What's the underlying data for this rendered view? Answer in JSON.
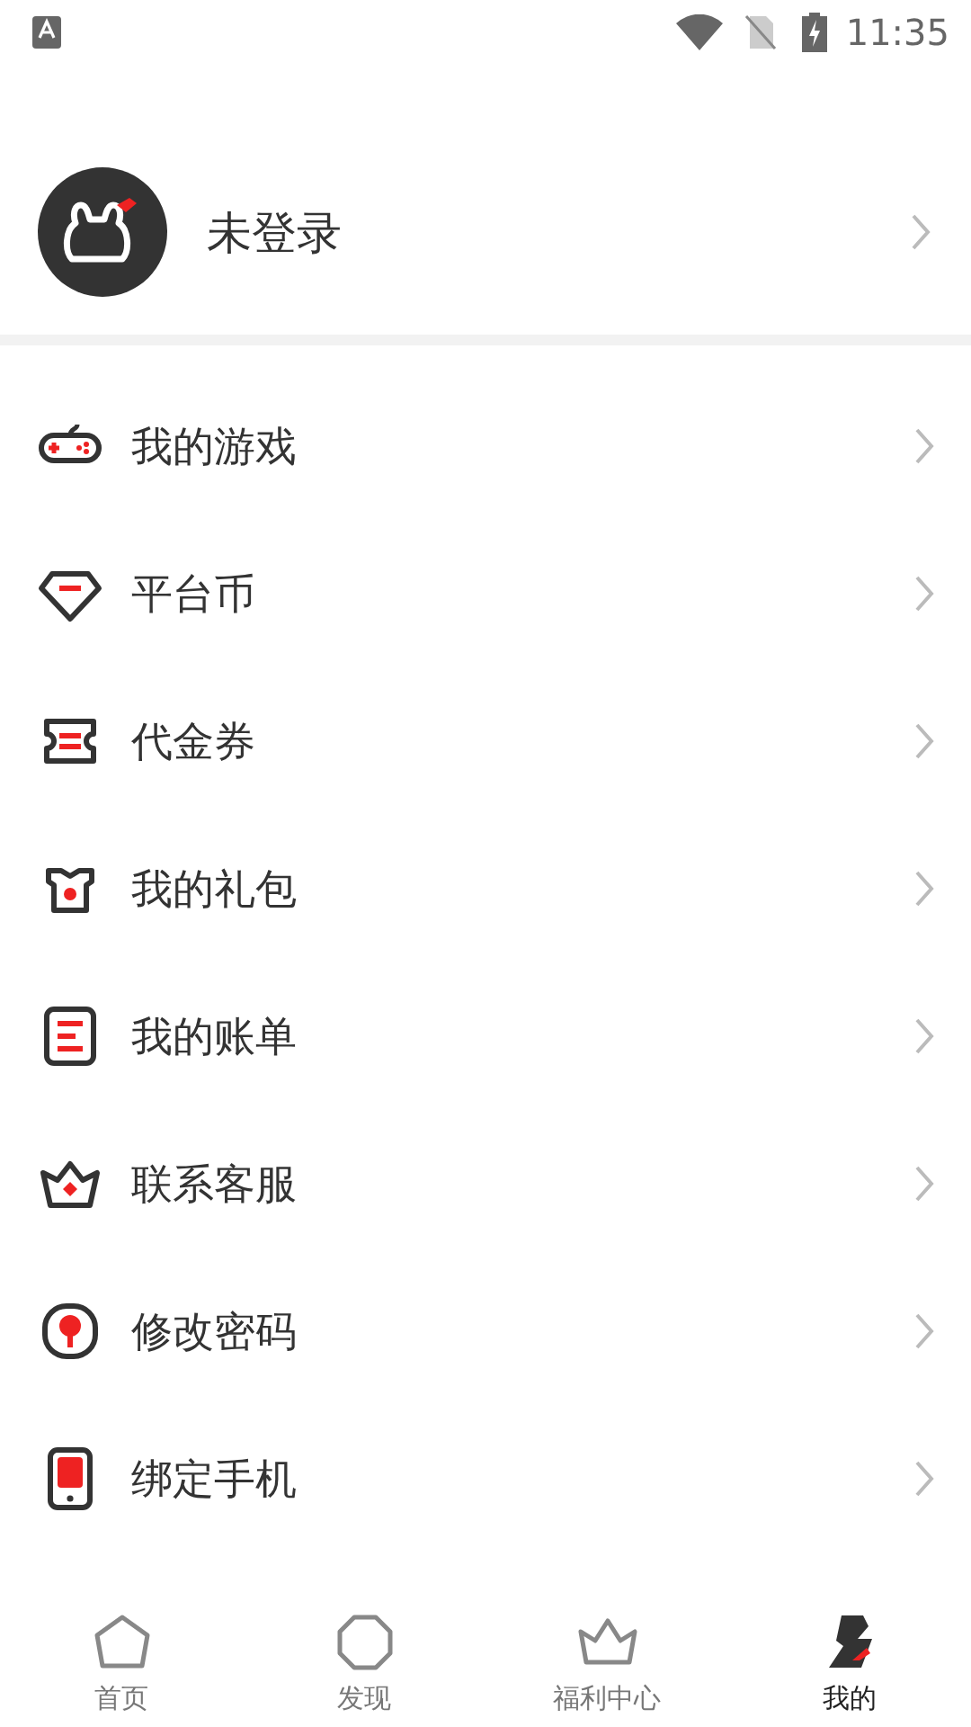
{
  "status_bar": {
    "time": "11:35"
  },
  "profile": {
    "name": "未登录"
  },
  "menu": [
    {
      "kind": "game",
      "label": "我的游戏"
    },
    {
      "kind": "coin",
      "label": "平台币"
    },
    {
      "kind": "voucher",
      "label": "代金券"
    },
    {
      "kind": "gift",
      "label": "我的礼包"
    },
    {
      "kind": "bill",
      "label": "我的账单"
    },
    {
      "kind": "service",
      "label": "联系客服"
    },
    {
      "kind": "password",
      "label": "修改密码"
    },
    {
      "kind": "phone",
      "label": "绑定手机"
    }
  ],
  "tab_bar": [
    {
      "kind": "home",
      "label": "首页",
      "selected": false
    },
    {
      "kind": "discover",
      "label": "发现",
      "selected": false
    },
    {
      "kind": "welfare",
      "label": "福利中心",
      "selected": false
    },
    {
      "kind": "mine",
      "label": "我的",
      "selected": true
    }
  ]
}
